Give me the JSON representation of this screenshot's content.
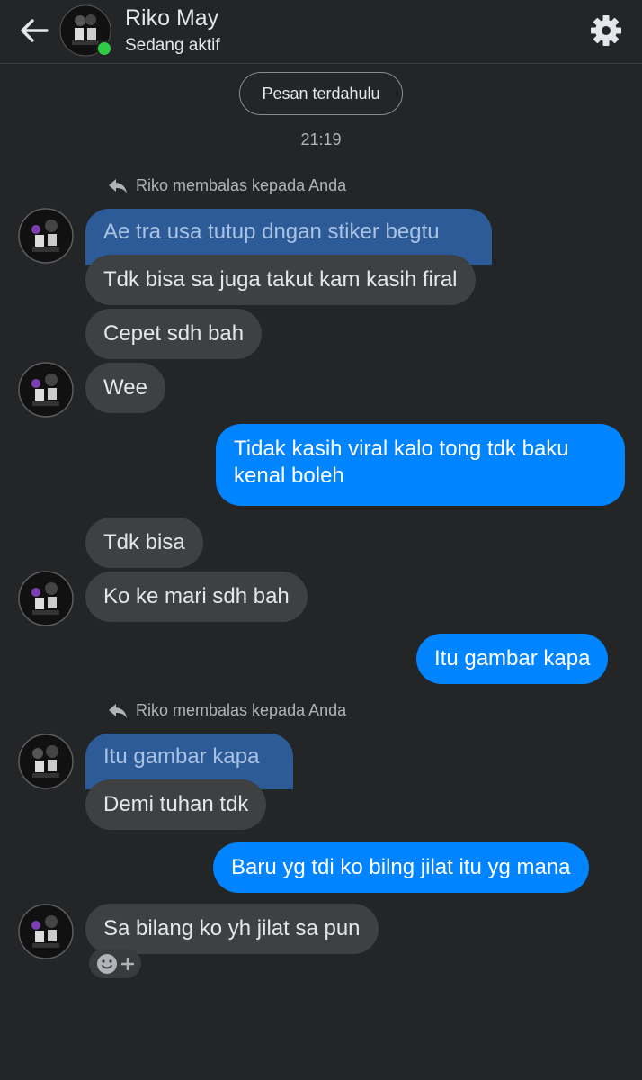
{
  "header": {
    "contact_name": "Riko May",
    "status": "Sedang aktif",
    "online_color": "#31cc46"
  },
  "earlier_messages_label": "Pesan terdahulu",
  "timestamp": "21:19",
  "reply_notes": [
    "Riko membalas kepada Anda",
    "Riko membalas kepada Anda"
  ],
  "messages": {
    "q1": "Ae tra usa tutup dngan stiker begtu",
    "m1": "Tdk bisa sa juga takut kam kasih  firal",
    "m2": "Cepet sdh bah",
    "m3": "Wee",
    "o1_line1": "Tidak kasih viral kalo tong tdk baku",
    "o1_line2": "kenal boleh",
    "m4": "Tdk bisa",
    "m5": "Ko ke mari sdh bah",
    "o2": "Itu gambar kapa",
    "q2": "Itu gambar kapa",
    "m6": "Demi tuhan tdk",
    "o3": "Baru yg tdi ko bilng jilat itu yg mana",
    "m7": "Sa bilang ko yh jilat sa pun"
  },
  "colors": {
    "background": "#242526",
    "incoming_bubble": "#3e4042",
    "outgoing_bubble": "#0084ff",
    "quoted_bubble": "#2d5b97"
  },
  "icons": [
    "back-arrow-icon",
    "gear-icon",
    "reply-icon",
    "smiley-icon",
    "plus-icon"
  ]
}
